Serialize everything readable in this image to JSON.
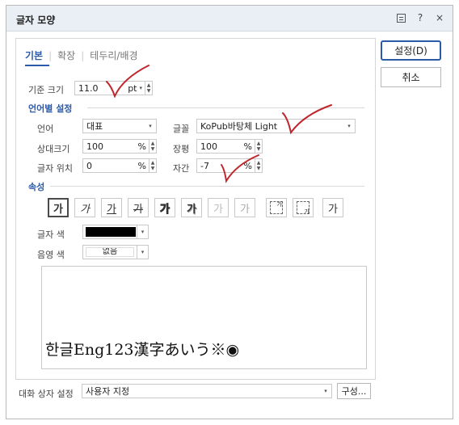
{
  "window": {
    "title": "글자 모양"
  },
  "titlebar": {
    "help_icon": "?",
    "close_icon": "×"
  },
  "tabs": [
    {
      "label": "기본"
    },
    {
      "label": "확장"
    },
    {
      "label": "테두리/배경"
    }
  ],
  "base_size": {
    "label": "기준 크기",
    "value": "11.0",
    "unit": "pt"
  },
  "lang_section": {
    "title": "언어별 설정"
  },
  "language": {
    "label": "언어",
    "value": "대표"
  },
  "font": {
    "label": "글꼴",
    "value": "KoPub바탕체 Light"
  },
  "rel_size": {
    "label": "상대크기",
    "value": "100",
    "unit": "%"
  },
  "width_ratio": {
    "label": "장평",
    "value": "100",
    "unit": "%"
  },
  "char_pos": {
    "label": "글자 위치",
    "value": "0",
    "unit": "%"
  },
  "spacing": {
    "label": "자간",
    "value": "-7",
    "unit": "%"
  },
  "attr_section": {
    "title": "속성"
  },
  "attributes": [
    "가",
    "가",
    "가",
    "가",
    "가",
    "가",
    "가",
    "가",
    "가",
    "가",
    "가"
  ],
  "text_color": {
    "label": "글자 색",
    "value": "#000000"
  },
  "shade_color": {
    "label": "음영 색",
    "value": "없음"
  },
  "preview": {
    "text": "한글Eng123漢字あいう※◉"
  },
  "dialog_setting": {
    "label": "대화 상자 설정",
    "value": "사용자 지정",
    "button": "구성..."
  },
  "buttons": {
    "ok": "설정(D)",
    "cancel": "취소"
  },
  "colors": {
    "accent": "#2b5aa8",
    "checkmark": "#c0262d"
  }
}
